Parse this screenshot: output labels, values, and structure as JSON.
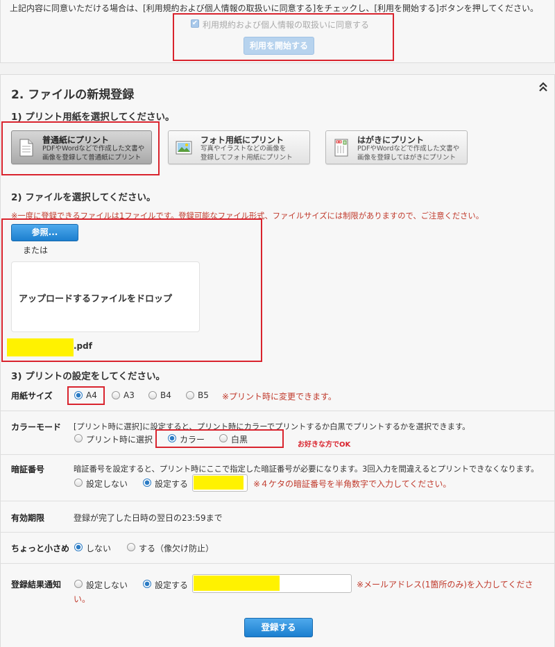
{
  "terms": {
    "instruction": "上記内容に同意いただける場合は、[利用規約および個人情報の取扱いに同意する]をチェックし、[利用を開始する]ボタンを押してください。",
    "agree_checkbox_label": "利用規約および個人情報の取扱いに同意する",
    "start_button": "利用を開始する"
  },
  "section": {
    "title": "2. ファイルの新規登録",
    "collapse_icon": "double-chevron-up-icon"
  },
  "step1": {
    "heading": "1) プリント用紙を選択してください。",
    "options": [
      {
        "title": "普通紙にプリント",
        "desc1": "PDFやWordなどで作成した文書や",
        "desc2": "画像を登録して普通紙にプリント",
        "icon": "document-icon",
        "selected": true
      },
      {
        "title": "フォト用紙にプリント",
        "desc1": "写真やイラストなどの画像を",
        "desc2": "登録してフォト用紙にプリント",
        "icon": "photo-icon",
        "selected": false
      },
      {
        "title": "はがきにプリント",
        "desc1": "PDFやWordなどで作成した文書や",
        "desc2": "画像を登録してはがきにプリント",
        "icon": "postcard-icon",
        "selected": false
      }
    ]
  },
  "step2": {
    "heading": "2) ファイルを選択してください。",
    "notice": "※一度に登録できるファイルは1ファイルです。登録可能なファイル形式、ファイルサイズには制限がありますので、ご注意ください。",
    "browse_button": "参照...",
    "or_text": "または",
    "drop_text": "アップロードするファイルをドロップ",
    "file_ext": ".pdf"
  },
  "step3": {
    "heading": "3) プリントの設定をしてください。",
    "paper_size": {
      "label": "用紙サイズ",
      "options": [
        "A4",
        "A3",
        "B4",
        "B5"
      ],
      "selected": "A4",
      "note": "※プリント時に変更できます。"
    },
    "color_mode": {
      "label": "カラーモード",
      "desc": "[プリント時に選択]に設定すると、プリント時にカラーでプリントするか白黒でプリントするかを選択できます。",
      "options": [
        "プリント時に選択",
        "カラー",
        "白黒"
      ],
      "selected": "カラー",
      "annotation": "お好きな方でOK"
    },
    "pin": {
      "label": "暗証番号",
      "desc": "暗証番号を設定すると、プリント時にここで指定した暗証番号が必要になります。3回入力を間違えるとプリントできなくなります。",
      "options": [
        "設定しない",
        "設定する"
      ],
      "selected": "設定する",
      "note": "※４ケタの暗証番号を半角数字で入力してください。"
    },
    "expiry": {
      "label": "有効期限",
      "value": "登録が完了した日時の翌日の23:59まで"
    },
    "shrink": {
      "label": "ちょっと小さめ",
      "options": [
        "しない",
        "する（像欠け防止）"
      ],
      "selected": "しない"
    },
    "notify": {
      "label": "登録結果通知",
      "options": [
        "設定しない",
        "設定する"
      ],
      "selected": "設定する",
      "note_line1": "※メールアドレス(1箇所のみ)を入力してくださ",
      "note_line2": "い。"
    }
  },
  "register_button": "登録する",
  "colors": {
    "accent_blue": "#2b7bc4",
    "annotation_red": "#d9232d",
    "redaction_yellow": "#fff200"
  }
}
